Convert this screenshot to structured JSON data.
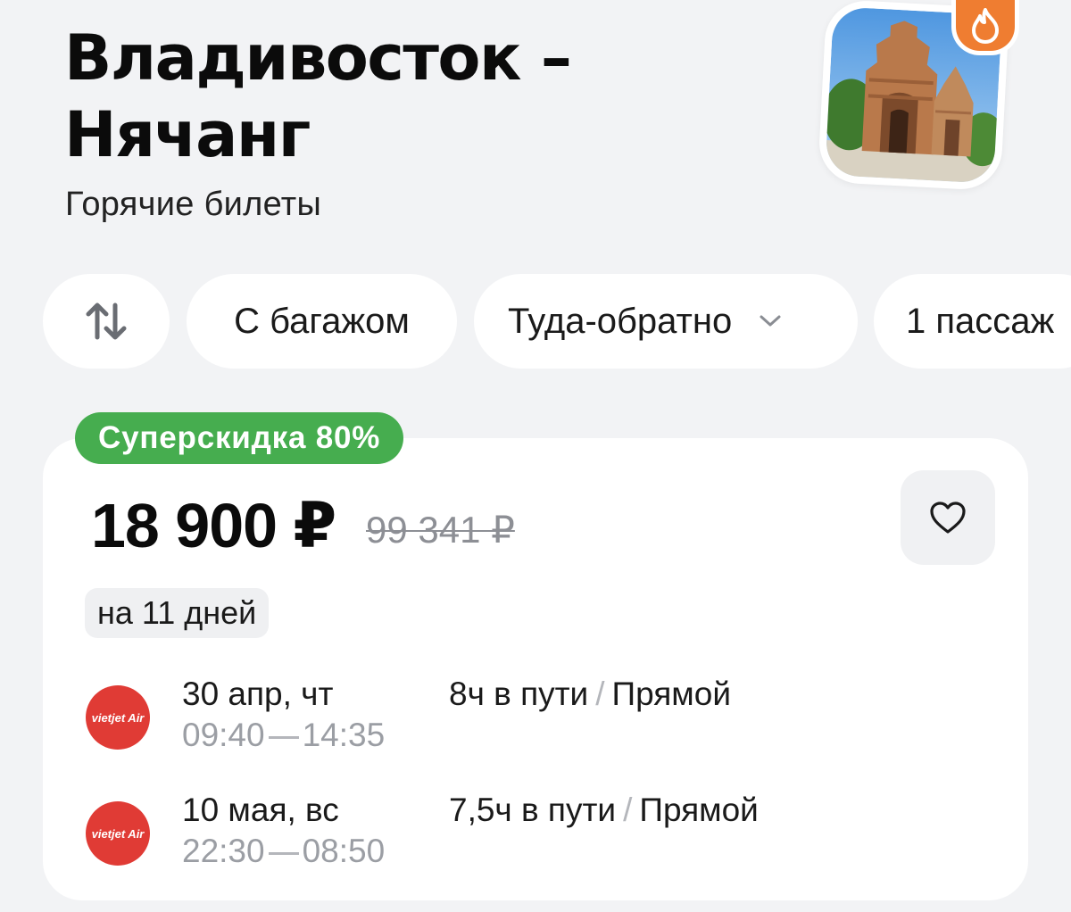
{
  "header": {
    "title_line1": "Владивосток –",
    "title_line2": "Нячанг",
    "subtitle": "Горячие билеты"
  },
  "filters": {
    "swap_icon": "swap-vertical-arrows-icon",
    "baggage_label": "С багажом",
    "trip_type_label": "Туда-обратно",
    "passengers_label": "1 пассаж"
  },
  "offer": {
    "badge": "Суперскидка 80%",
    "price": "18 900 ₽",
    "old_price": "99 341 ₽",
    "duration_days": "на 11 дней",
    "favorite_icon": "heart-icon",
    "legs": [
      {
        "airline": "VietJet Air",
        "logo_text": "vietjet Air",
        "date": "30 апр, чт",
        "depart": "09:40",
        "arrive": "14:35",
        "travel_time": "8ч в пути",
        "sep": "/",
        "stops": "Прямой"
      },
      {
        "airline": "VietJet Air",
        "logo_text": "vietjet Air",
        "date": "10 мая, вс",
        "depart": "22:30",
        "arrive": "08:50",
        "travel_time": "7,5ч в пути",
        "sep": "/",
        "stops": "Прямой"
      }
    ]
  },
  "colors": {
    "background": "#f2f3f5",
    "badge_green": "#46ad4f",
    "fire_orange": "#ef7d31",
    "airline_red": "#e03b35",
    "muted_text": "#9b9ea4"
  }
}
